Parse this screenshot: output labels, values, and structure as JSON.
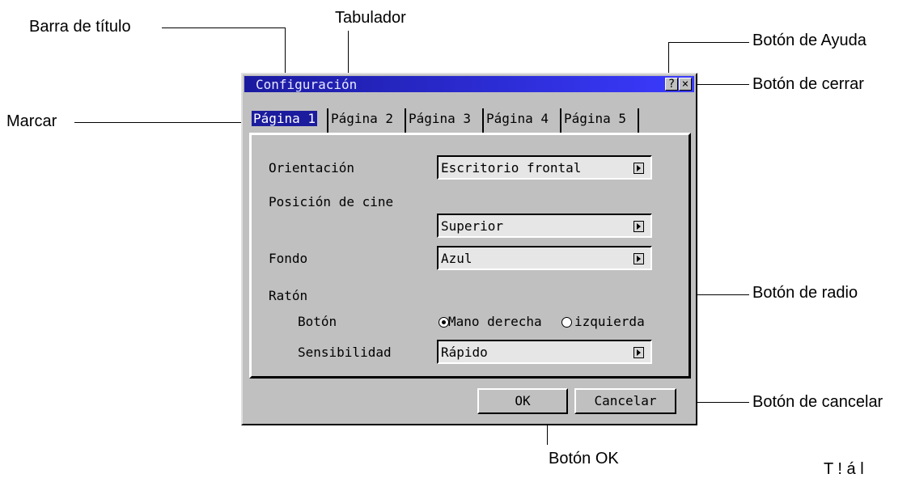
{
  "callouts": {
    "title_bar": "Barra de título",
    "tab": "Tabulador",
    "help_button": "Botón de Ayuda",
    "close_button": "Botón de cerrar",
    "mark": "Marcar",
    "radio_button": "Botón de radio",
    "cancel_button": "Botón de cancelar",
    "ok_button": "Botón OK",
    "cut_text": "T ! á   l"
  },
  "dialog": {
    "title": "Configuración",
    "help_glyph": "?",
    "close_glyph": "×",
    "tabs": [
      {
        "label": "Página 1",
        "active": true
      },
      {
        "label": "Página 2",
        "active": false
      },
      {
        "label": "Página 3",
        "active": false
      },
      {
        "label": "Página 4",
        "active": false
      },
      {
        "label": "Página 5",
        "active": false
      }
    ],
    "fields": {
      "orientation_label": "Orientación",
      "orientation_value": "Escritorio frontal",
      "cinema_label": "Posición de cine",
      "cinema_value": "Superior",
      "background_label": "Fondo",
      "background_value": "Azul",
      "mouse_label": "Ratón",
      "button_label": "Botón",
      "radio_right": "Mano derecha",
      "radio_left": "izquierda",
      "sensitivity_label": "Sensibilidad",
      "sensitivity_value": "Rápido"
    },
    "ok_label": "OK",
    "cancel_label": "Cancelar"
  }
}
